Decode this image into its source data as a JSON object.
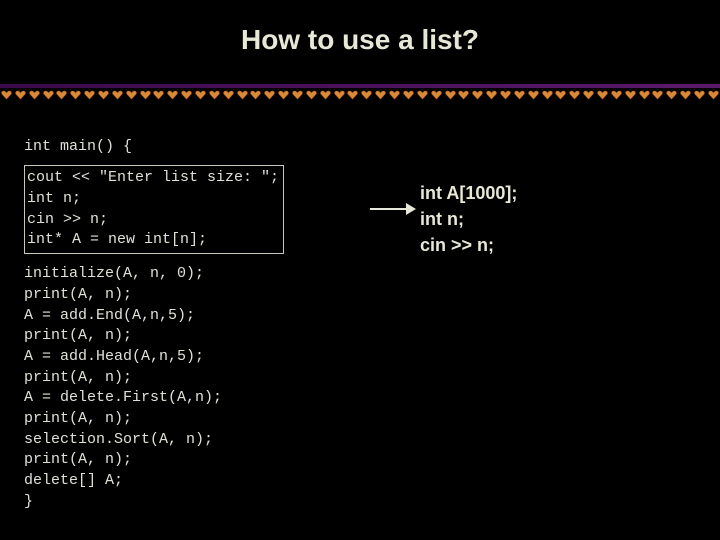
{
  "title": "How to use a list?",
  "code": {
    "line_main": "int main() {",
    "box_l1": "cout << \"Enter list size: \";",
    "box_l2": "int n;",
    "box_l3": "cin >> n;",
    "box_l4": "int* A = new int[n];",
    "rest_l1": "initialize(A, n, 0);",
    "rest_l2": "print(A, n);",
    "rest_l3": "A = add.End(A,n,5);",
    "rest_l4": "print(A, n);",
    "rest_l5": "A = add.Head(A,n,5);",
    "rest_l6": "print(A, n);",
    "rest_l7": "A = delete.First(A,n);",
    "rest_l8": "print(A, n);",
    "rest_l9": "selection.Sort(A, n);",
    "rest_l10": "print(A, n);",
    "rest_l11": "delete[] A;",
    "rest_l12": "}"
  },
  "right": {
    "l1": "int A[1000];",
    "l2": "int n;",
    "l3": "cin >> n;"
  },
  "colors": {
    "heart_fill": "#d68a3a",
    "heart_stroke": "#b85a1a",
    "arrow": "#e8e8d8"
  },
  "heart_count": 52
}
